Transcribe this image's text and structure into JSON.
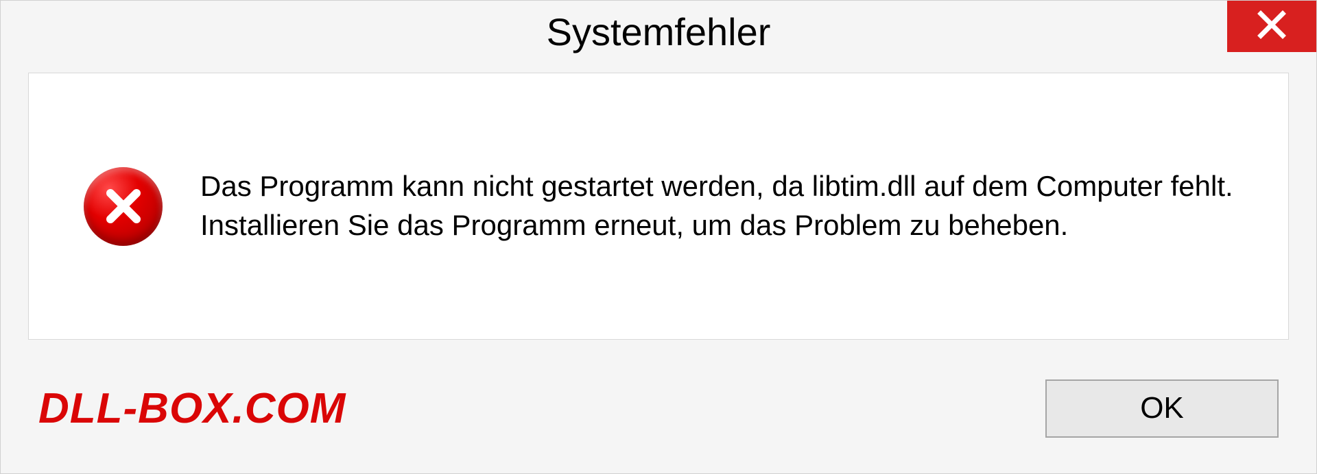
{
  "dialog": {
    "title": "Systemfehler",
    "message": "Das Programm kann nicht gestartet werden, da libtim.dll auf dem Computer fehlt. Installieren Sie das Programm erneut, um das Problem zu beheben.",
    "ok_label": "OK"
  },
  "watermark": "DLL-BOX.COM",
  "colors": {
    "close_bg": "#d8201f",
    "error_icon": "#e30000",
    "watermark": "#da0606"
  }
}
